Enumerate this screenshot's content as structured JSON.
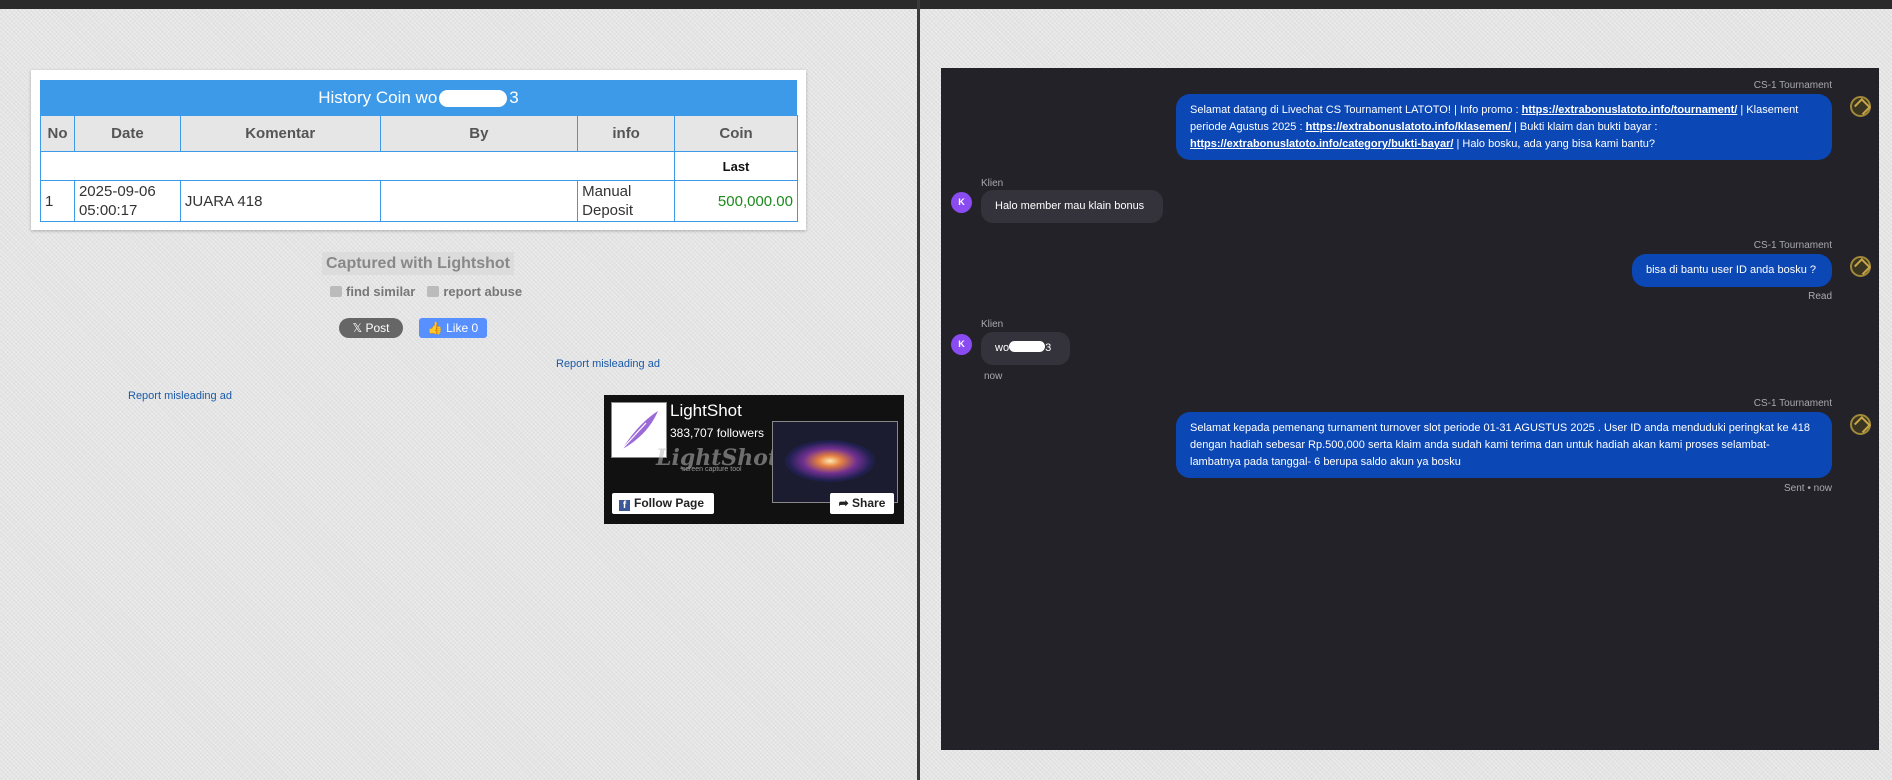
{
  "left": {
    "history": {
      "title_prefix": "History Coin wo",
      "title_suffix": "3",
      "columns": [
        "No",
        "Date",
        "Komentar",
        "By",
        "info",
        "Coin"
      ],
      "subheader": "Last",
      "rows": [
        {
          "no": "1",
          "date": "2025-09-06 05:00:17",
          "komentar": "JUARA 418",
          "by": "",
          "info": "Manual Deposit",
          "coin": "500,000.00"
        }
      ]
    },
    "captured": "Captured with Lightshot",
    "find_similar": "find similar",
    "report_abuse": "report abuse",
    "x_post": "Post",
    "fb_like": "Like 0",
    "report_ad_1": "Report misleading ad",
    "report_ad_2": "Report misleading ad",
    "lightshot_widget": {
      "title": "LightShot",
      "followers": "383,707 followers",
      "brand": "LightShot",
      "brand_sub": "screen capture tool",
      "follow": "Follow Page",
      "share": "Share"
    }
  },
  "chat": {
    "agent_name": "CS-1 Tournament",
    "client_name": "Klien",
    "client_initial": "K",
    "msg1": {
      "t1": "Selamat datang di Livechat CS Tournament LATOTO! | Info promo : ",
      "link1": "https://extrabonuslatoto.info/tournament/",
      "t2": " | Klasement periode Agustus 2025 : ",
      "link2": "https://extrabonuslatoto.info/klasemen/",
      "t3": " | Bukti klaim dan bukti bayar : ",
      "link3": "https://extrabonuslatoto.info/category/bukti-bayar/",
      "t4": " | Halo bosku, ada yang bisa kami bantu?"
    },
    "msg2": "Halo member mau klain bonus",
    "msg3": "bisa di bantu user ID anda bosku ?",
    "msg3_status": "Read",
    "msg4_prefix": "wo",
    "msg4_suffix": "3",
    "msg4_time": "now",
    "msg5": "Selamat kepada pemenang turnament turnover slot periode 01-31 AGUSTUS 2025 . User ID anda menduduki peringkat ke 418 dengan hadiah sebesar Rp.500,000 serta klaim anda sudah kami terima dan untuk hadiah akan kami proses selambat-lambatnya pada tanggal- 6 berupa saldo akun ya bosku",
    "msg5_status": "Sent • now"
  }
}
